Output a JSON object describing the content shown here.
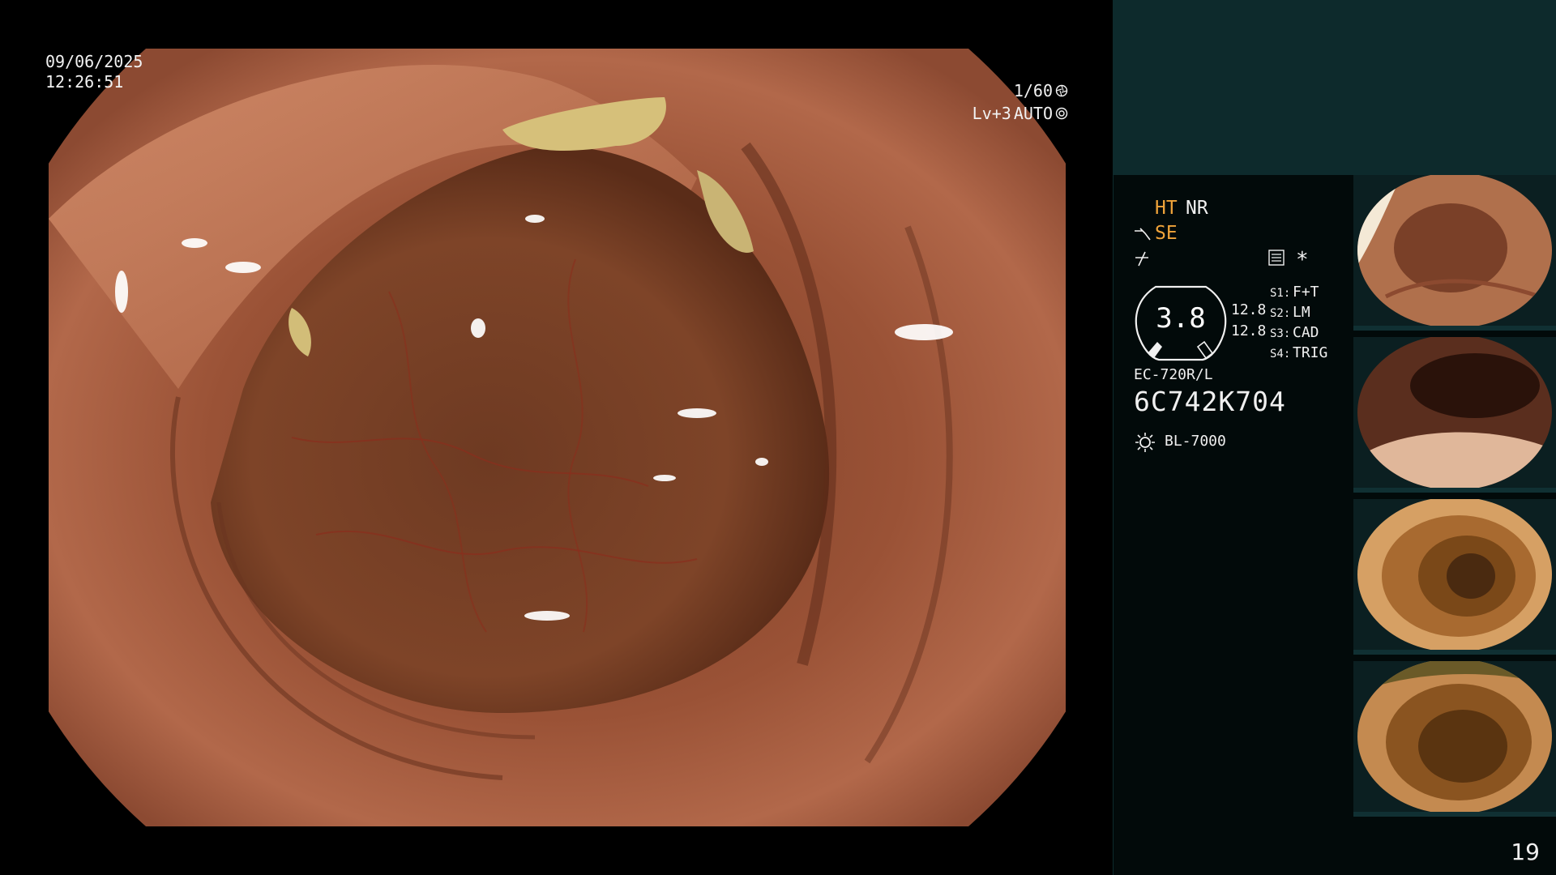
{
  "overlay": {
    "date": "09/06/2025",
    "time": "12:26:51",
    "shutter": "1/60",
    "level": "Lv+3",
    "iris_mode": "AUTO"
  },
  "panel": {
    "ht": "HT",
    "nr": "NR",
    "se": "SE",
    "s1_key": "S1:",
    "s1_val": "F+T",
    "s2_key": "S2:",
    "s2_val": "LM",
    "s3_key": "S3:",
    "s3_val": "CAD",
    "s4_key": "S4:",
    "s4_val": "TRIG",
    "gauge_value": "3.8",
    "gauge_top": "12.8",
    "gauge_bottom": "12.8",
    "asterisk": "*",
    "scope_model": "EC-720R/L",
    "scope_serial": "6C742K704",
    "light_source": "BL-7000",
    "page_number": "19"
  },
  "icons": {
    "shutter": "aperture-icon",
    "iris": "iris-icon",
    "structure": "structure-enhancement-icon",
    "hook": "hook-icon",
    "memo": "memo-icon",
    "light": "light-source-icon"
  },
  "colors": {
    "panel_bg": "#020a0a",
    "header_bg": "#0d2a2c",
    "accent_orange": "#f0a43a",
    "text": "#f0f0f0"
  },
  "thumbnails": [
    {
      "label": "captured-image-1"
    },
    {
      "label": "captured-image-2"
    },
    {
      "label": "captured-image-3"
    },
    {
      "label": "captured-image-4"
    }
  ]
}
